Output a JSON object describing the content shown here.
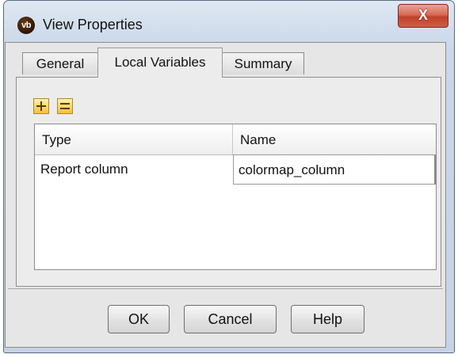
{
  "window": {
    "title": "View Properties",
    "app_icon_text": "vb",
    "close_symbol": "X"
  },
  "tabs": [
    {
      "label": "General",
      "active": false
    },
    {
      "label": "Local Variables",
      "active": true
    },
    {
      "label": "Summary",
      "active": false
    }
  ],
  "toolbar": {
    "add_icon": "plus-icon",
    "remove_icon": "remove-rows-icon"
  },
  "table": {
    "columns": [
      "Type",
      "Name"
    ],
    "rows": [
      {
        "type": "Report column",
        "name": "colormap_column"
      }
    ]
  },
  "buttons": {
    "ok": "OK",
    "cancel": "Cancel",
    "help": "Help"
  },
  "colors": {
    "close_button": "#c9503a",
    "icon_fill": "#f0c23c",
    "panel_bg": "#ececec"
  }
}
